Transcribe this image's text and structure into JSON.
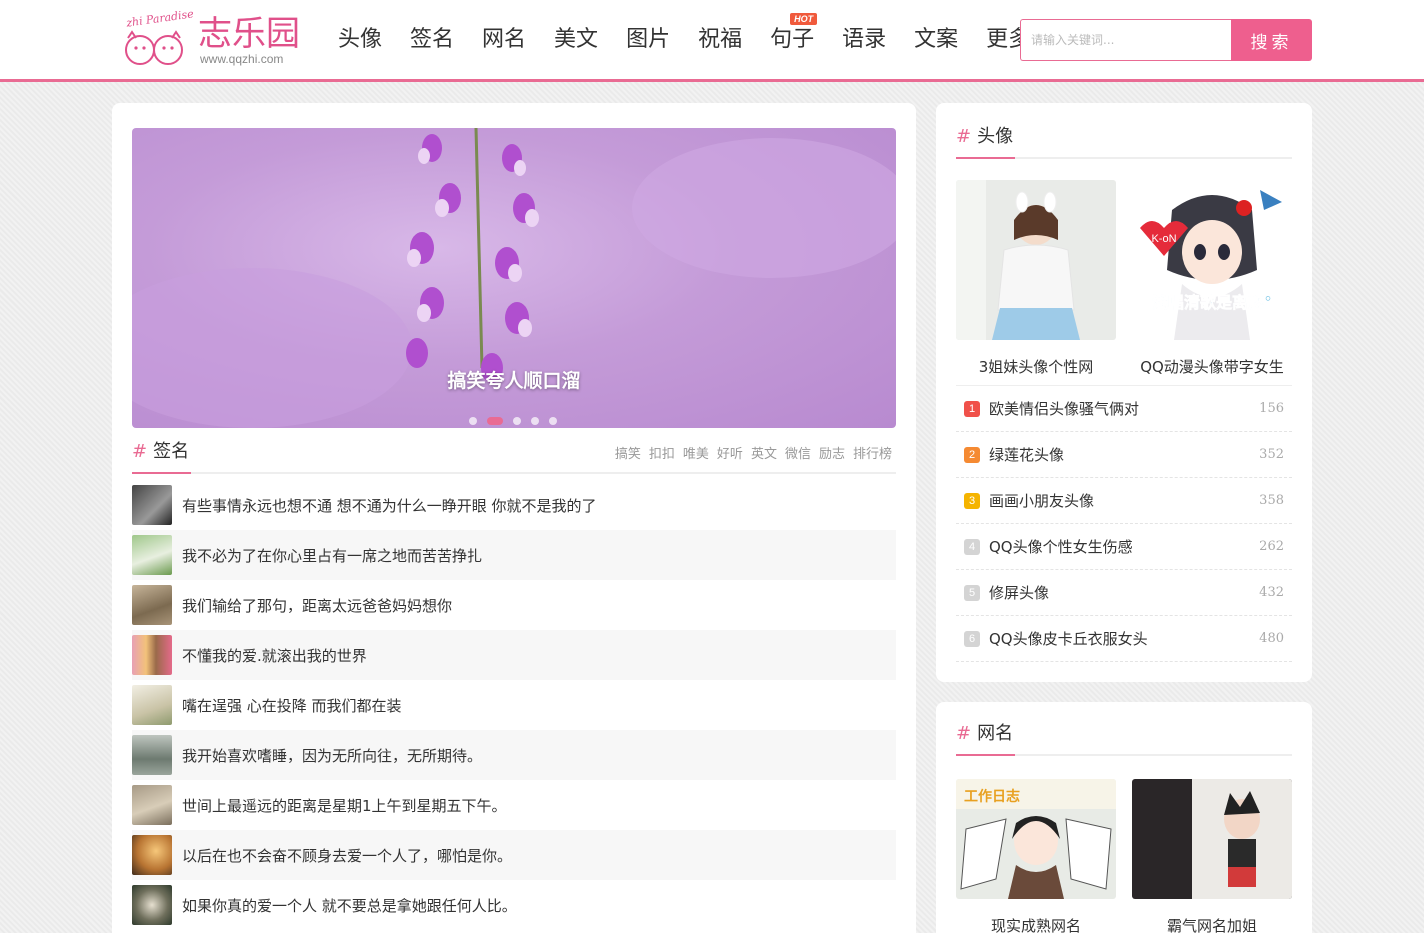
{
  "header": {
    "logo_en": "zhi Paradise",
    "logo_cn": "志乐园",
    "logo_url": "www.qqzhi.com",
    "nav": [
      {
        "label": "头像"
      },
      {
        "label": "签名"
      },
      {
        "label": "网名"
      },
      {
        "label": "美文"
      },
      {
        "label": "图片"
      },
      {
        "label": "祝福"
      },
      {
        "label": "句子",
        "badge": "HOT"
      },
      {
        "label": "语录"
      },
      {
        "label": "文案"
      },
      {
        "label": "更多"
      }
    ],
    "search": {
      "placeholder": "请输入关键词...",
      "button": "搜索"
    }
  },
  "main": {
    "banner": {
      "caption": "搞笑夸人顺口溜",
      "slides": 5,
      "active": 2
    },
    "signature": {
      "title": "签名",
      "tags": [
        "搞笑",
        "扣扣",
        "唯美",
        "好听",
        "英文",
        "微信",
        "励志",
        "排行榜"
      ],
      "items": [
        "有些事情永远也想不通 想不通为什么一睁开眼 你就不是我的了",
        "我不必为了在你心里占有一席之地而苦苦挣扎",
        "我们输给了那句，距离太远爸爸妈妈想你",
        "不懂我的爱.就滚出我的世界",
        "嘴在逞强 心在投降 而我们都在装",
        "我开始喜欢嗜睡，因为无所向往，无所期待。",
        "世间上最遥远的距离是星期1上午到星期五下午。",
        "以后在也不会奋不顾身去爱一个人了，哪怕是你。",
        "如果你真的爱一个人 就不要总是拿她跟任何人比。"
      ]
    }
  },
  "sidebar": {
    "avatar": {
      "title": "头像",
      "cards": [
        {
          "label": "3姐妹头像个性网"
        },
        {
          "label": "QQ动漫头像带字女生",
          "img_text": "浅唱清歌是离愁°",
          "badge_text": "K-oN"
        }
      ],
      "ranking": [
        {
          "rank": "1",
          "title": "欧美情侣头像骚气俩对",
          "count": "156",
          "color": "#f0514a"
        },
        {
          "rank": "2",
          "title": "绿莲花头像",
          "count": "352",
          "color": "#f58a32"
        },
        {
          "rank": "3",
          "title": "画画小朋友头像",
          "count": "358",
          "color": "#f5b400"
        },
        {
          "rank": "4",
          "title": "QQ头像个性女生伤感",
          "count": "262",
          "color": "#d4d4d4"
        },
        {
          "rank": "5",
          "title": "修屏头像",
          "count": "432",
          "color": "#d4d4d4"
        },
        {
          "rank": "6",
          "title": "QQ头像皮卡丘衣服女头",
          "count": "480",
          "color": "#d4d4d4"
        }
      ]
    },
    "netname": {
      "title": "网名",
      "cards": [
        {
          "label": "现实成熟网名",
          "img_text": "工作日志"
        },
        {
          "label": "霸气网名加姐"
        }
      ]
    }
  },
  "colors": {
    "accent": "#e96b93",
    "search_button": "#ee5f8e"
  }
}
